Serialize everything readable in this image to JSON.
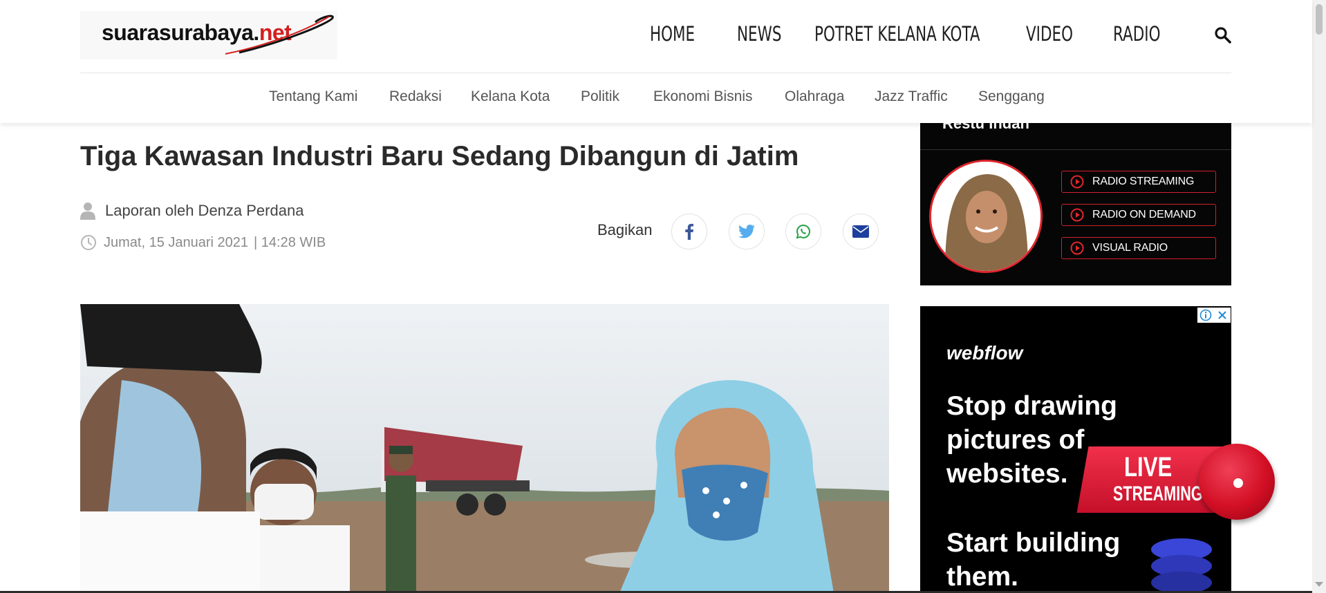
{
  "site": {
    "logo_text": "suarasurabaya.",
    "logo_tld": "net"
  },
  "main_nav": {
    "items": [
      "HOME",
      "NEWS",
      "POTRET KELANA KOTA",
      "VIDEO",
      "RADIO"
    ],
    "search_icon": "search-icon"
  },
  "sub_nav": {
    "items": [
      "Tentang Kami",
      "Redaksi",
      "Kelana Kota",
      "Politik",
      "Ekonomi Bisnis",
      "Olahraga",
      "Jazz Traffic",
      "Senggang"
    ]
  },
  "article": {
    "title": "Tiga Kawasan Industri Baru Sedang Dibangun di Jatim",
    "author": "Laporan oleh Denza Perdana",
    "date": "Jumat, 15 Januari 2021",
    "time": "| 14:28 WIB",
    "share_label": "Bagikan",
    "share_icons": [
      "facebook-icon",
      "twitter-icon",
      "whatsapp-icon",
      "email-icon"
    ]
  },
  "radio": {
    "host": "Restu Indah",
    "buttons": [
      "RADIO STREAMING",
      "RADIO ON DEMAND",
      "VISUAL RADIO"
    ]
  },
  "ad": {
    "brand": "webflow",
    "headline": "Stop drawing pictures of websites.",
    "subline": "Start building them.",
    "info_icon": "info-icon",
    "close_icon": "close-icon"
  },
  "live": {
    "line1": "LIVE",
    "line2": "STREAMING"
  },
  "colors": {
    "brand_red": "#d41f1f",
    "radio_red": "#e0262d",
    "facebook": "#3b5998",
    "twitter": "#55acee",
    "whatsapp": "#25a244",
    "email": "#1e3f9c"
  }
}
